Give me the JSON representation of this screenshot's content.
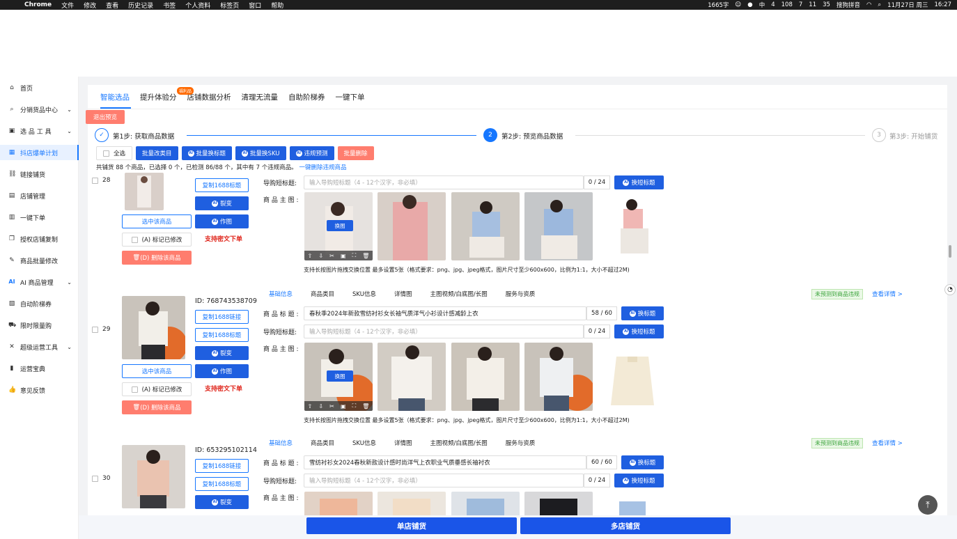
{
  "menubar": {
    "app": "Chrome",
    "items": [
      "文件",
      "修改",
      "查看",
      "历史记录",
      "书签",
      "个人资料",
      "标签页",
      "窗口",
      "帮助"
    ],
    "status": {
      "chars": "1665字",
      "notif1": "4",
      "notif2": "108",
      "notif3": "7",
      "wechat": "11",
      "notif4": "35",
      "ime": "搜狗拼音",
      "date": "11月27日 周三",
      "time": "16:27"
    }
  },
  "sidebar": {
    "items": [
      {
        "label": "首页",
        "icon": "home-icon",
        "arrow": false
      },
      {
        "label": "分销货品中心",
        "icon": "search-icon",
        "arrow": true
      },
      {
        "label": "选 品 工 具",
        "icon": "tool-icon",
        "arrow": true
      },
      {
        "label": "抖店爆单计划",
        "icon": "grid-icon",
        "arrow": false,
        "active": true
      },
      {
        "label": "链接铺货",
        "icon": "link-icon",
        "arrow": false
      },
      {
        "label": "店铺管理",
        "icon": "store-icon",
        "arrow": false
      },
      {
        "label": "一键下单",
        "icon": "order-icon",
        "arrow": false
      },
      {
        "label": "授权店铺复制",
        "icon": "copy-icon",
        "arrow": false
      },
      {
        "label": "商品批量修改",
        "icon": "edit-icon",
        "arrow": false
      },
      {
        "label": "AI 商品管理",
        "icon": "ai-icon",
        "arrow": true
      },
      {
        "label": "自动阶梯券",
        "icon": "coupon-icon",
        "arrow": false
      },
      {
        "label": "限时限量购",
        "icon": "cart-icon",
        "arrow": false
      },
      {
        "label": "超级运营工具",
        "icon": "wrench-icon",
        "arrow": true
      },
      {
        "label": "运营宝典",
        "icon": "book-icon",
        "arrow": false
      },
      {
        "label": "意见反馈",
        "icon": "thumb-icon",
        "arrow": false
      }
    ]
  },
  "tabs": [
    "智能选品",
    "提升体验分",
    "店铺数据分析",
    "清理无流量",
    "自助阶梯券",
    "一键下单"
  ],
  "tab_badge": "福利品",
  "exit_preview": "退出预览",
  "steps": [
    "第1步: 获取商品数据",
    "第2步: 预览商品数据",
    "第3步: 开始铺货"
  ],
  "step_nums": [
    "2",
    "3"
  ],
  "toolbar": {
    "select_all": "全选",
    "batch_category": "批量改类目",
    "batch_title": "批量换标题",
    "batch_sku": "批量换SKU",
    "violation": "违规预测",
    "batch_delete": "批量删除"
  },
  "summary": {
    "text": "共铺货 88 个商品，已选择 0 个，已检测 86/88 个，其中有 7 个违规商品。",
    "link": "一键删除违规商品"
  },
  "labels": {
    "copy_link": "复制1688链接",
    "copy_title": "复制1688标题",
    "split": "裂变",
    "make_image": "作图",
    "select_product": "选中该商品",
    "mark_modified": "(A) 标记已修改",
    "delete_product": "(D) 删除该商品",
    "password_order": "支持密文下单",
    "product_title": "商 品 标 题 :",
    "short_title": "导购短标题:",
    "main_image": "商 品 主 图 :",
    "short_placeholder": "输入导购短标题（4 - 12个汉字，非必填）",
    "short_count": "0 / 24",
    "change_title": "换标题",
    "change_short": "换短标题",
    "swap_image": "换图",
    "image_note": "支持长按图片拖拽交换位置  最多设置5张（格式要求：png、jpg、jpeg格式，图片尺寸至少600x600，比例为1:1，大小不超过2M)",
    "subtabs": [
      "基础信息",
      "商品类目",
      "SKU信息",
      "详情图",
      "主图视频/白底图/长图",
      "服务与资质"
    ],
    "no_violation": "未预测到商品违规",
    "view_detail": "查看详情 >"
  },
  "products": [
    {
      "num": "28"
    },
    {
      "num": "29",
      "id": "ID: 768743538709",
      "title": "春秋季2024年新款雪纺衬衫女长袖气质洋气小衫设计感减龄上衣",
      "count": "58 / 60"
    },
    {
      "num": "30",
      "id": "ID: 653295102114",
      "title": "雪纺衬衫女2024春秋新款设计感时尚洋气上衣职业气质垂感长袖衬衣",
      "count": "60 / 60"
    }
  ],
  "bottom": {
    "single": "单店铺货",
    "multi": "多店铺货"
  }
}
